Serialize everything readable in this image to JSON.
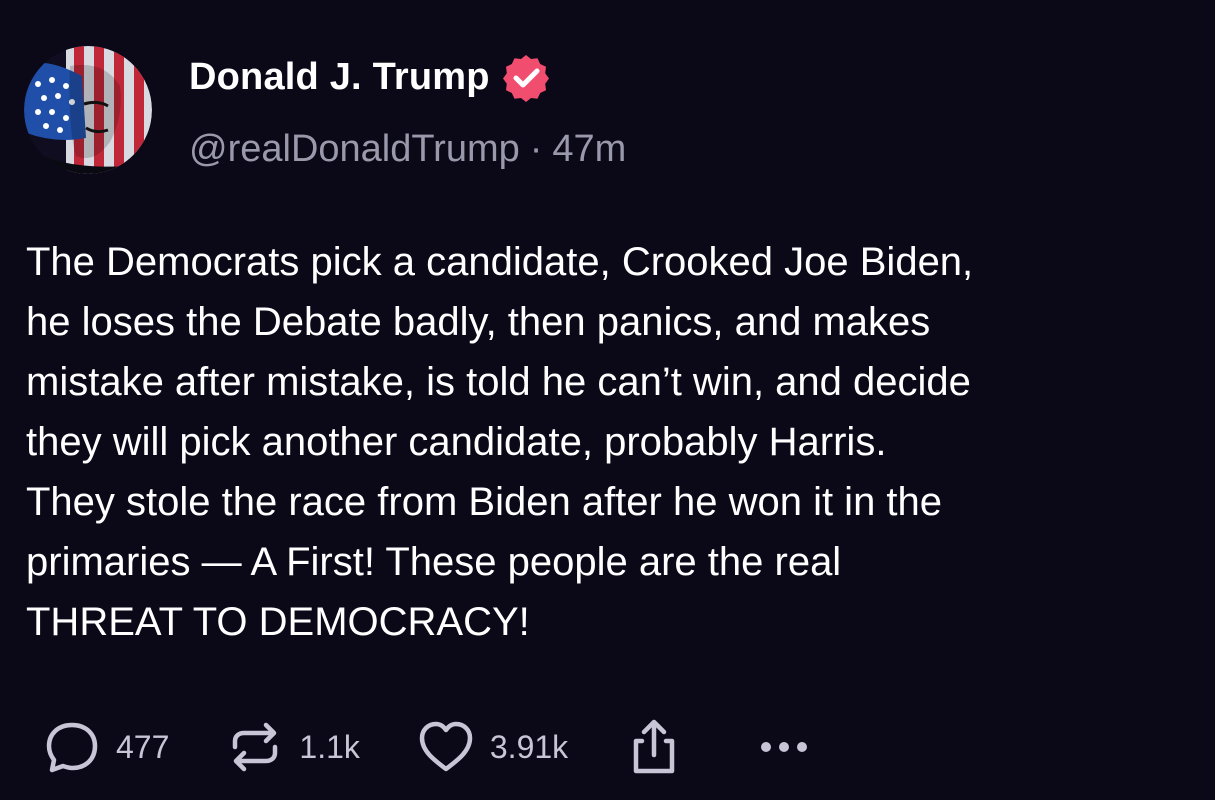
{
  "post": {
    "author": {
      "display_name": "Donald J. Trump",
      "handle": "@realDonaldTrump",
      "separator": "·",
      "time_ago": "47m",
      "verified_icon": "verified-badge-icon",
      "verified_color": "#f04d6f"
    },
    "body": "The Democrats pick a candidate, Crooked Joe Biden,\nhe loses the Debate badly, then panics, and makes\nmistake after mistake, is told he can’t win, and decide\nthey will pick another candidate, probably Harris.\nThey stole the race from Biden after he won it in the\nprimaries — A First! These people are the real\nTHREAT TO DEMOCRACY!",
    "actions": {
      "reply": {
        "icon": "reply-bubble-icon",
        "count": "477"
      },
      "repost": {
        "icon": "repost-icon",
        "count": "1.1k"
      },
      "like": {
        "icon": "heart-icon",
        "count": "3.91k"
      },
      "share": {
        "icon": "share-upload-icon"
      },
      "more": {
        "icon": "more-dots-icon"
      }
    }
  },
  "colors": {
    "background": "#0b0918",
    "text": "#ffffff",
    "secondary_text": "#9a98ab",
    "action_text": "#c8c6d6"
  }
}
